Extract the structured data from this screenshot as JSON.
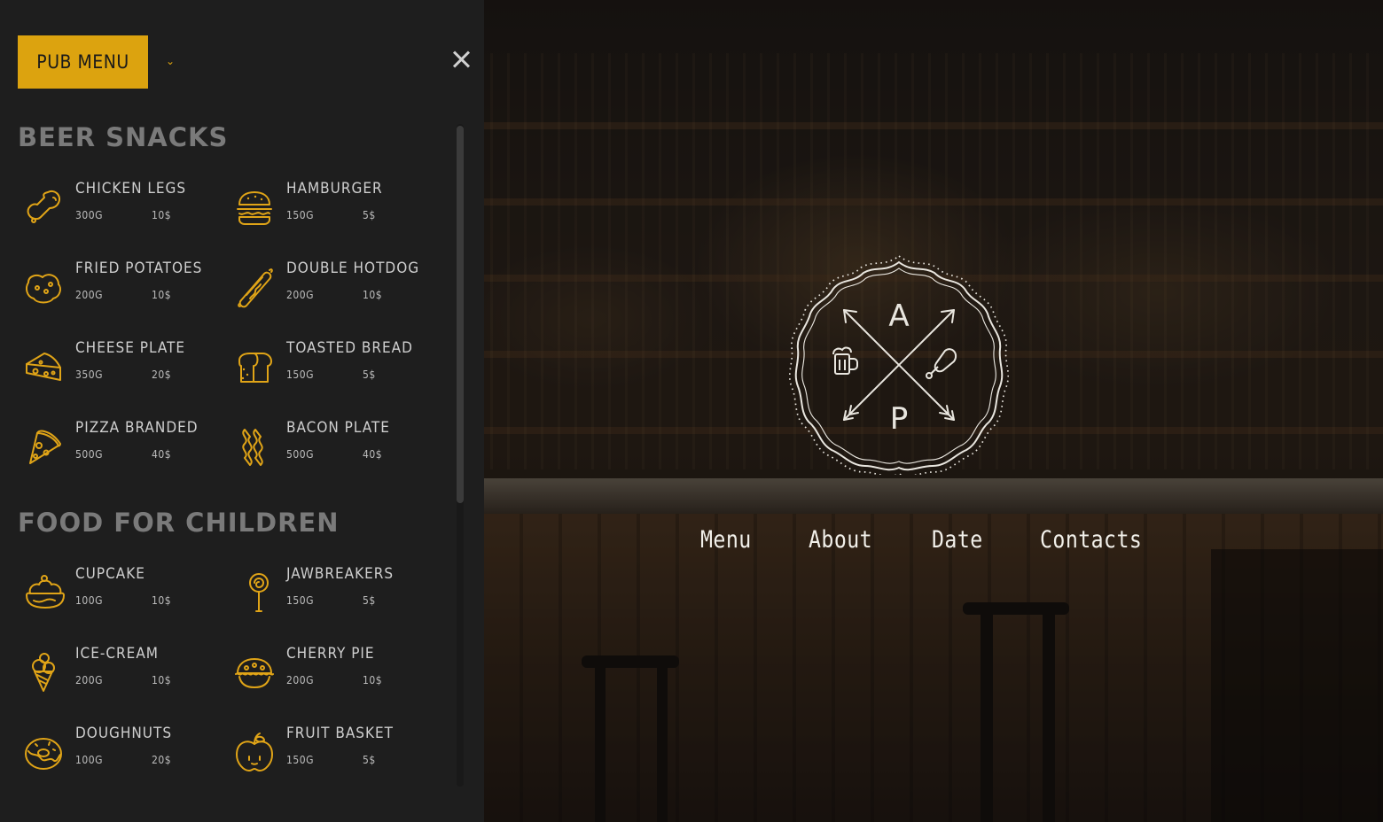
{
  "header": {
    "menu_button": "PUB MENU",
    "caret": "⌄",
    "close_label": "close"
  },
  "colors": {
    "accent": "#dca30f",
    "panel_bg": "#1e1e1e",
    "section_title": "#7a7a7a"
  },
  "sections": [
    {
      "title": "BEER SNACKS",
      "items": [
        {
          "name": "CHICKEN LEGS",
          "weight": "300G",
          "price": "10$",
          "icon": "chicken-leg-icon"
        },
        {
          "name": "HAMBURGER",
          "weight": "150G",
          "price": "5$",
          "icon": "hamburger-icon"
        },
        {
          "name": "FRIED POTATOES",
          "weight": "200G",
          "price": "10$",
          "icon": "potatoes-icon"
        },
        {
          "name": "DOUBLE HOTDOG",
          "weight": "200G",
          "price": "10$",
          "icon": "hotdog-icon"
        },
        {
          "name": "CHEESE PLATE",
          "weight": "350G",
          "price": "20$",
          "icon": "cheese-icon"
        },
        {
          "name": "TOASTED BREAD",
          "weight": "150G",
          "price": "5$",
          "icon": "bread-icon"
        },
        {
          "name": "PIZZA BRANDED",
          "weight": "500G",
          "price": "40$",
          "icon": "pizza-icon"
        },
        {
          "name": "BACON PLATE",
          "weight": "500G",
          "price": "40$",
          "icon": "bacon-icon"
        }
      ]
    },
    {
      "title": "FOOD FOR CHILDREN",
      "items": [
        {
          "name": "CUPCAKE",
          "weight": "100G",
          "price": "10$",
          "icon": "cupcake-icon"
        },
        {
          "name": "JAWBREAKERS",
          "weight": "150G",
          "price": "5$",
          "icon": "lollipop-icon"
        },
        {
          "name": "ICE-CREAM",
          "weight": "200G",
          "price": "10$",
          "icon": "ice-cream-icon"
        },
        {
          "name": "CHERRY PIE",
          "weight": "200G",
          "price": "10$",
          "icon": "pie-icon"
        },
        {
          "name": "DOUGHNUTS",
          "weight": "100G",
          "price": "20$",
          "icon": "doughnut-icon"
        },
        {
          "name": "FRUIT BASKET",
          "weight": "150G",
          "price": "5$",
          "icon": "apple-icon"
        }
      ]
    }
  ],
  "emblem": {
    "top_letter": "A",
    "bottom_letter": "P"
  },
  "nav": [
    "Menu",
    "About",
    "Date",
    "Contacts"
  ]
}
